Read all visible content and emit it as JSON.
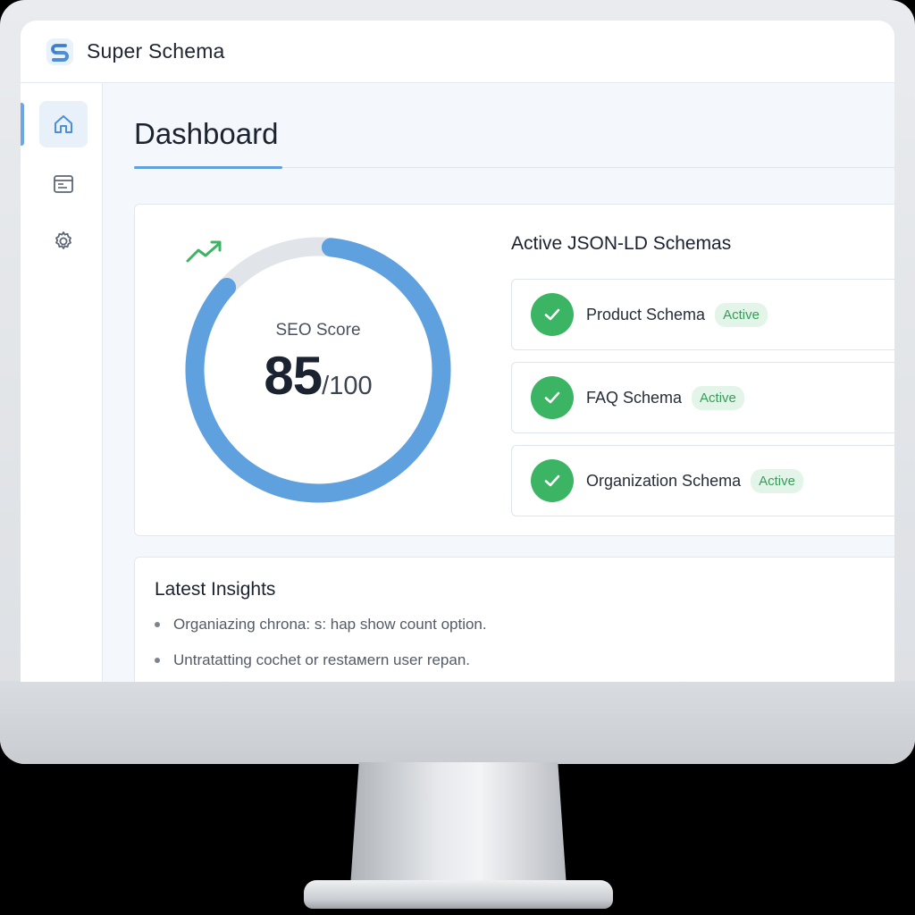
{
  "app": {
    "title": "Super Schema",
    "logo_icon": "super-schema-logo"
  },
  "sidebar": {
    "items": [
      {
        "name": "home",
        "icon": "home-icon",
        "active": true
      },
      {
        "name": "schemas",
        "icon": "browser-window-icon",
        "active": false
      },
      {
        "name": "settings",
        "icon": "gear-icon",
        "active": false
      }
    ]
  },
  "page": {
    "title": "Dashboard"
  },
  "seo_score": {
    "label": "SEO Score",
    "value": "85",
    "max": "/100",
    "fraction": 0.85,
    "trend_icon": "trending-up-icon"
  },
  "schemas": {
    "heading": "Active JSON-LD Schemas",
    "items": [
      {
        "name": "Product Schema",
        "status": "Active"
      },
      {
        "name": "FAQ Schema",
        "status": "Active"
      },
      {
        "name": "Organization Schema",
        "status": "Active"
      }
    ]
  },
  "insights": {
    "title": "Latest Insights",
    "items": [
      "Organiazing chrona: s: hap show count option.",
      "Untratatting cochet or restaмern user repan."
    ]
  },
  "colors": {
    "accent": "#5fa0de",
    "gauge_track": "#e1e5ea",
    "success": "#3bb563",
    "badge_bg": "#e2f5e8",
    "badge_text": "#3a9a5a"
  }
}
